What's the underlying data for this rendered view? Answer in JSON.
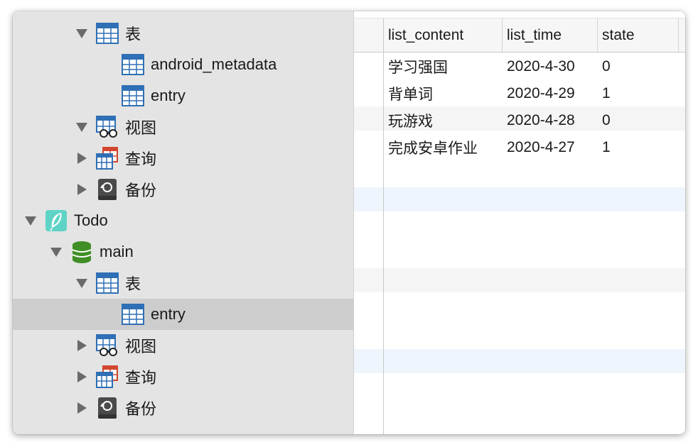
{
  "sidebar": {
    "items": [
      {
        "label": "表",
        "icon": "table-icon",
        "expanded": true
      },
      {
        "label": "android_metadata",
        "icon": "table-icon"
      },
      {
        "label": "entry",
        "icon": "table-icon"
      },
      {
        "label": "视图",
        "icon": "view-icon",
        "expanded": true
      },
      {
        "label": "查询",
        "icon": "query-icon",
        "expanded": false
      },
      {
        "label": "备份",
        "icon": "backup-icon",
        "expanded": false
      },
      {
        "label": "Todo",
        "icon": "feather-icon",
        "expanded": true
      },
      {
        "label": "main",
        "icon": "database-icon",
        "expanded": true
      },
      {
        "label": "表",
        "icon": "table-icon",
        "expanded": true
      },
      {
        "label": "entry",
        "icon": "table-icon",
        "selected": true
      },
      {
        "label": "视图",
        "icon": "view-icon",
        "expanded": false
      },
      {
        "label": "查询",
        "icon": "query-icon",
        "expanded": false
      },
      {
        "label": "备份",
        "icon": "backup-icon",
        "expanded": false
      }
    ]
  },
  "table": {
    "columns": [
      "list_content",
      "list_time",
      "state"
    ],
    "rows": [
      [
        "学习强国",
        "2020-4-30",
        "0"
      ],
      [
        "背单词",
        "2020-4-29",
        "1"
      ],
      [
        "玩游戏",
        "2020-4-28",
        "0"
      ],
      [
        "完成安卓作业",
        "2020-4-27",
        "1"
      ]
    ]
  },
  "colors": {
    "sidebar_bg": "#e4e4e4",
    "selected_row": "#cdcdcd",
    "table_icon_blue": "#2f6fb5",
    "database_green": "#3f8f26",
    "feather_teal": "#5fd3c6"
  }
}
